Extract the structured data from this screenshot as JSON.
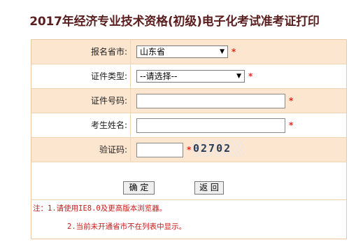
{
  "page": {
    "title": "2017年经济专业技术资格(初级)电子化考试准考证打印"
  },
  "form": {
    "province": {
      "label": "报名省市:",
      "value": "山东省",
      "required_mark": "*"
    },
    "id_type": {
      "label": "证件类型:",
      "value": "--请选择--",
      "required_mark": "*"
    },
    "id_number": {
      "label": "证件号码:",
      "value": "",
      "required_mark": "*"
    },
    "name": {
      "label": "考生姓名:",
      "value": "",
      "required_mark": "*"
    },
    "captcha": {
      "label": "验证码:",
      "value": "",
      "required_mark": "*",
      "image_text": "02702"
    },
    "confirm_label": "确 定",
    "back_label": "返 回"
  },
  "notes": {
    "line1": "注：1.请使用IE8.0及更高版本浏览器。",
    "line2": "2.当前未开通省市不在列表中显示。"
  },
  "colors": {
    "row_highlight": "#fde6d0",
    "border": "#e8c9a6",
    "required": "#e2271c",
    "title": "#5a1e1e",
    "note": "#c81b1b"
  }
}
